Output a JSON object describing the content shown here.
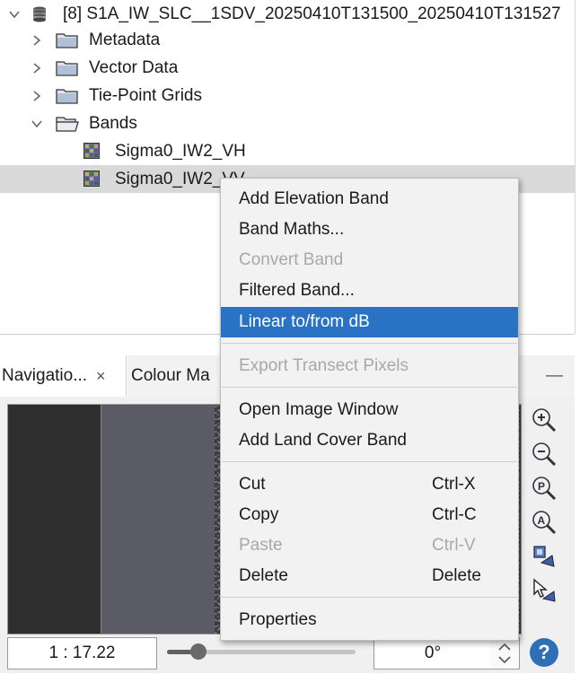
{
  "tree": {
    "product": "[8] S1A_IW_SLC__1SDV_20250410T131500_20250410T131527",
    "items": [
      {
        "label": "Metadata"
      },
      {
        "label": "Vector Data"
      },
      {
        "label": "Tie-Point Grids"
      },
      {
        "label": "Bands"
      }
    ],
    "bands": [
      {
        "label": "Sigma0_IW2_VH"
      },
      {
        "label": "Sigma0_IW2_VV"
      }
    ]
  },
  "tabs": [
    {
      "label": "Navigatio..."
    },
    {
      "label": "Colour Ma"
    }
  ],
  "tab_close": "×",
  "panel_minimize": "—",
  "context_menu": {
    "items": [
      {
        "label": "Add Elevation Band",
        "shortcut": ""
      },
      {
        "label": "Band Maths...",
        "shortcut": ""
      },
      {
        "label": "Convert Band",
        "shortcut": ""
      },
      {
        "label": "Filtered Band...",
        "shortcut": ""
      },
      {
        "label": "Linear to/from dB",
        "shortcut": ""
      },
      {
        "label": "Export Transect Pixels",
        "shortcut": ""
      },
      {
        "label": "Open Image Window",
        "shortcut": ""
      },
      {
        "label": "Add Land Cover Band",
        "shortcut": ""
      },
      {
        "label": "Cut",
        "shortcut": "Ctrl-X"
      },
      {
        "label": "Copy",
        "shortcut": "Ctrl-C"
      },
      {
        "label": "Paste",
        "shortcut": "Ctrl-V"
      },
      {
        "label": "Delete",
        "shortcut": "Delete"
      },
      {
        "label": "Properties",
        "shortcut": ""
      }
    ]
  },
  "navigation": {
    "scale": "1 : 17.22",
    "angle": "0°",
    "help": "?"
  },
  "colors": {
    "highlight": "#2a73c4",
    "selected_row": "#d9d9d9",
    "help_button": "#2f6fb8"
  }
}
